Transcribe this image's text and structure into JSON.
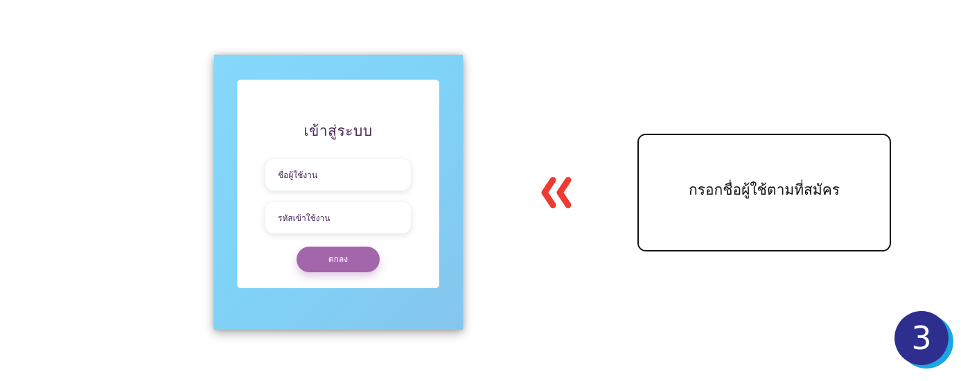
{
  "login": {
    "title": "เข้าสู่ระบบ",
    "username_placeholder": "ชื่อผู้ใช้งาน",
    "password_placeholder": "รหัสเข้าใช้งาน",
    "submit_label": "ตกลง"
  },
  "instruction": {
    "text": "กรอกชื่อผู้ใช้ตามที่สมัคร"
  },
  "step": {
    "number": "3"
  },
  "icons": {
    "arrow": "double-chevron-left-icon"
  },
  "colors": {
    "panel_background": "#7fd3f7",
    "title_text": "#4c2a58",
    "button": "#a466ab",
    "arrow": "#ee3a31",
    "step_badge_front": "#2e2e8e",
    "step_badge_back": "#1aa6e6"
  }
}
